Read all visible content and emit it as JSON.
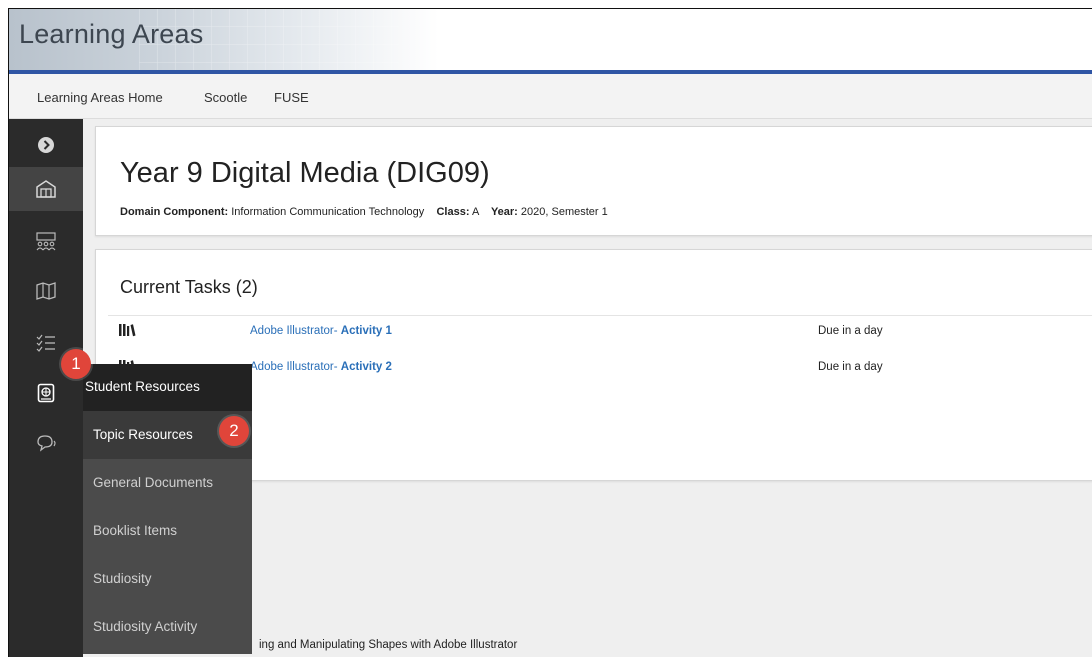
{
  "header": {
    "title": "Learning Areas"
  },
  "nav": {
    "links": [
      "Learning Areas Home",
      "Scootle",
      "FUSE"
    ]
  },
  "sidebar": {
    "icons": [
      "chevron-right-icon",
      "building-icon",
      "people-group-icon",
      "map-icon",
      "checklist-icon",
      "web-resources-icon",
      "chat-icon"
    ]
  },
  "course": {
    "title": "Year 9 Digital Media (DIG09)",
    "domain_label": "Domain Component:",
    "domain_value": "Information Communication Technology",
    "class_label": "Class:",
    "class_value": "A",
    "year_label": "Year:",
    "year_value": "2020, Semester 1"
  },
  "tasks": {
    "title": "Current Tasks (2)",
    "rows": [
      {
        "prefix": "Adobe Illustrator- ",
        "name": "Activity 1",
        "due": "Due in a day"
      },
      {
        "prefix": "Adobe Illustrator- ",
        "name": "Activity 2",
        "due": "Due in a day"
      }
    ]
  },
  "bottom_text": "ing and Manipulating Shapes with Adobe Illustrator",
  "flyout": {
    "header": "Student Resources",
    "items": [
      "Topic Resources",
      "General Documents",
      "Booklist Items",
      "Studiosity",
      "Studiosity Activity"
    ],
    "active_index": 0
  },
  "badges": [
    "1",
    "2"
  ],
  "colors": {
    "accent": "#2f55a4",
    "link": "#2a6fb8",
    "badge": "#e0453a",
    "sidebar": "#2b2b2b"
  }
}
